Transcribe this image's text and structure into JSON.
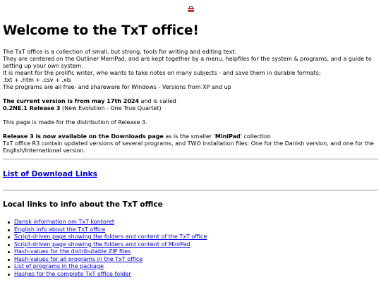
{
  "header": {
    "icon": "toolbox-icon",
    "title": "Welcome to the TxT office!"
  },
  "intro": {
    "line1": "The TxT office is a collection of small, but strong, tools for writing and editing text.",
    "line2": "They are centered on the Outliner MemPad, and are kept together by a menu, helpfiles for the system & programs, and a guide to setting up your own system.",
    "line3": "It is meant for the prolific writer, who wants to take notes on many subjects - and save them in durable formats;",
    "line4": ".txt + .htm + .csv + .xls",
    "line5": "The programs are all free- and shareware for Windows - Versions from XP and up"
  },
  "version": {
    "bold_prefix": "The current version is from may 17th 2024",
    "middle": " and is called",
    "release_name": "0.2NE.1 Release 3",
    "release_desc": " (New Evolution - One True Quartet)"
  },
  "distribution_note": "This page is made for the distribution of Release 3.",
  "release_info": {
    "bold_prefix": "Release 3 is now available on the Downloads page",
    "middle": " as is the smaller '",
    "minipad": "MiniPad",
    "suffix": "' collection",
    "line2": "TxT office R3 contain updated versions of several programs, and TWO installation files: One for the Danish version, and one for the English/International version."
  },
  "download_link": "List of Download Links",
  "local_links": {
    "heading": "Local links to info about the TxT office",
    "items": [
      "Dansk information om TxT kontoret",
      "English info about the TxT office",
      "Script-driven page showing the folders and content of the TxT office",
      "Script-driven page showing the folders and content of MiniPad",
      "Hash-values for the distributable ZIP files",
      "Hash-values for all programs in the TxT office",
      "List of programs in the package",
      "Hashes for the complete TxT office folder"
    ]
  }
}
